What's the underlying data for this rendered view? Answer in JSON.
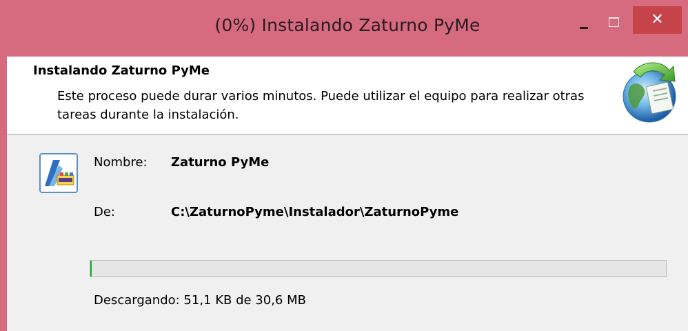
{
  "window": {
    "title": "(0%) Instalando Zaturno PyMe",
    "close_glyph": "✕"
  },
  "header": {
    "title": "Instalando Zaturno PyMe",
    "description": "Este proceso puede durar varios minutos. Puede utilizar el equipo para realizar otras tareas durante la instalación."
  },
  "details": {
    "name_label": "Nombre:",
    "name_value": "Zaturno PyMe",
    "from_label": "De:",
    "from_value": "C:\\ZaturnoPyme\\Instalador\\ZaturnoPyme"
  },
  "progress": {
    "fraction": 0.002,
    "status": "Descargando: 51,1 KB de 30,6 MB"
  },
  "colors": {
    "titlebar": "#d66b80",
    "close_button": "#c7434a",
    "progress_fill": "#06b025"
  },
  "icons": {
    "header": "globe-setup-icon",
    "app": "zaturno-app-icon"
  }
}
